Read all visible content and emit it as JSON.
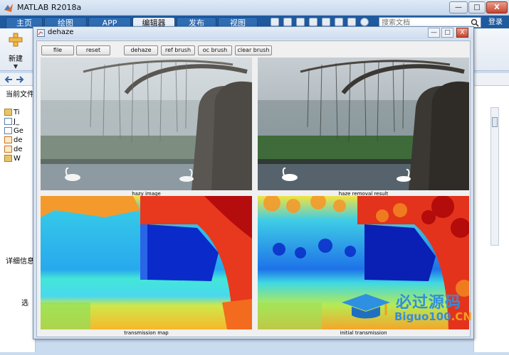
{
  "window": {
    "title": "MATLAB R2018a",
    "min_label": "—",
    "max_label": "□",
    "close_label": "X"
  },
  "ribbon": {
    "tabs": [
      {
        "label": "主页"
      },
      {
        "label": "绘图"
      },
      {
        "label": "APP"
      },
      {
        "label": "编辑器"
      },
      {
        "label": "发布"
      },
      {
        "label": "视图"
      }
    ],
    "search_placeholder": "搜索文档",
    "login_label": "登录",
    "new_label": "新建",
    "dropdown_glyph": "▼"
  },
  "current_folder": {
    "title": "当前文件夹",
    "files": [
      {
        "name": "Ti",
        "icon": "folder-icon"
      },
      {
        "name": "J_",
        "icon": "file-icon"
      },
      {
        "name": "Ge",
        "icon": "file-icon"
      },
      {
        "name": "de",
        "icon": "m-file-icon"
      },
      {
        "name": "de",
        "icon": "m-file-icon"
      },
      {
        "name": "W",
        "icon": "folder-icon"
      }
    ],
    "details_title": "详细信息",
    "select_hint": "选"
  },
  "figure": {
    "title": "dehaze",
    "buttons": {
      "file": "file",
      "reset": "reset",
      "dehaze": "dehaze",
      "ref_brush": "ref brush",
      "oc_brush": "oc brush",
      "clear_brush": "clear brush"
    },
    "panels": {
      "hazy": "hazy image",
      "result": "haze removal result",
      "tmap": "transmission map",
      "initial": "initial transmission"
    }
  },
  "watermark": {
    "line1": "必过源码",
    "line2_main": "Biguo100",
    "line2_suffix": ".CN"
  }
}
